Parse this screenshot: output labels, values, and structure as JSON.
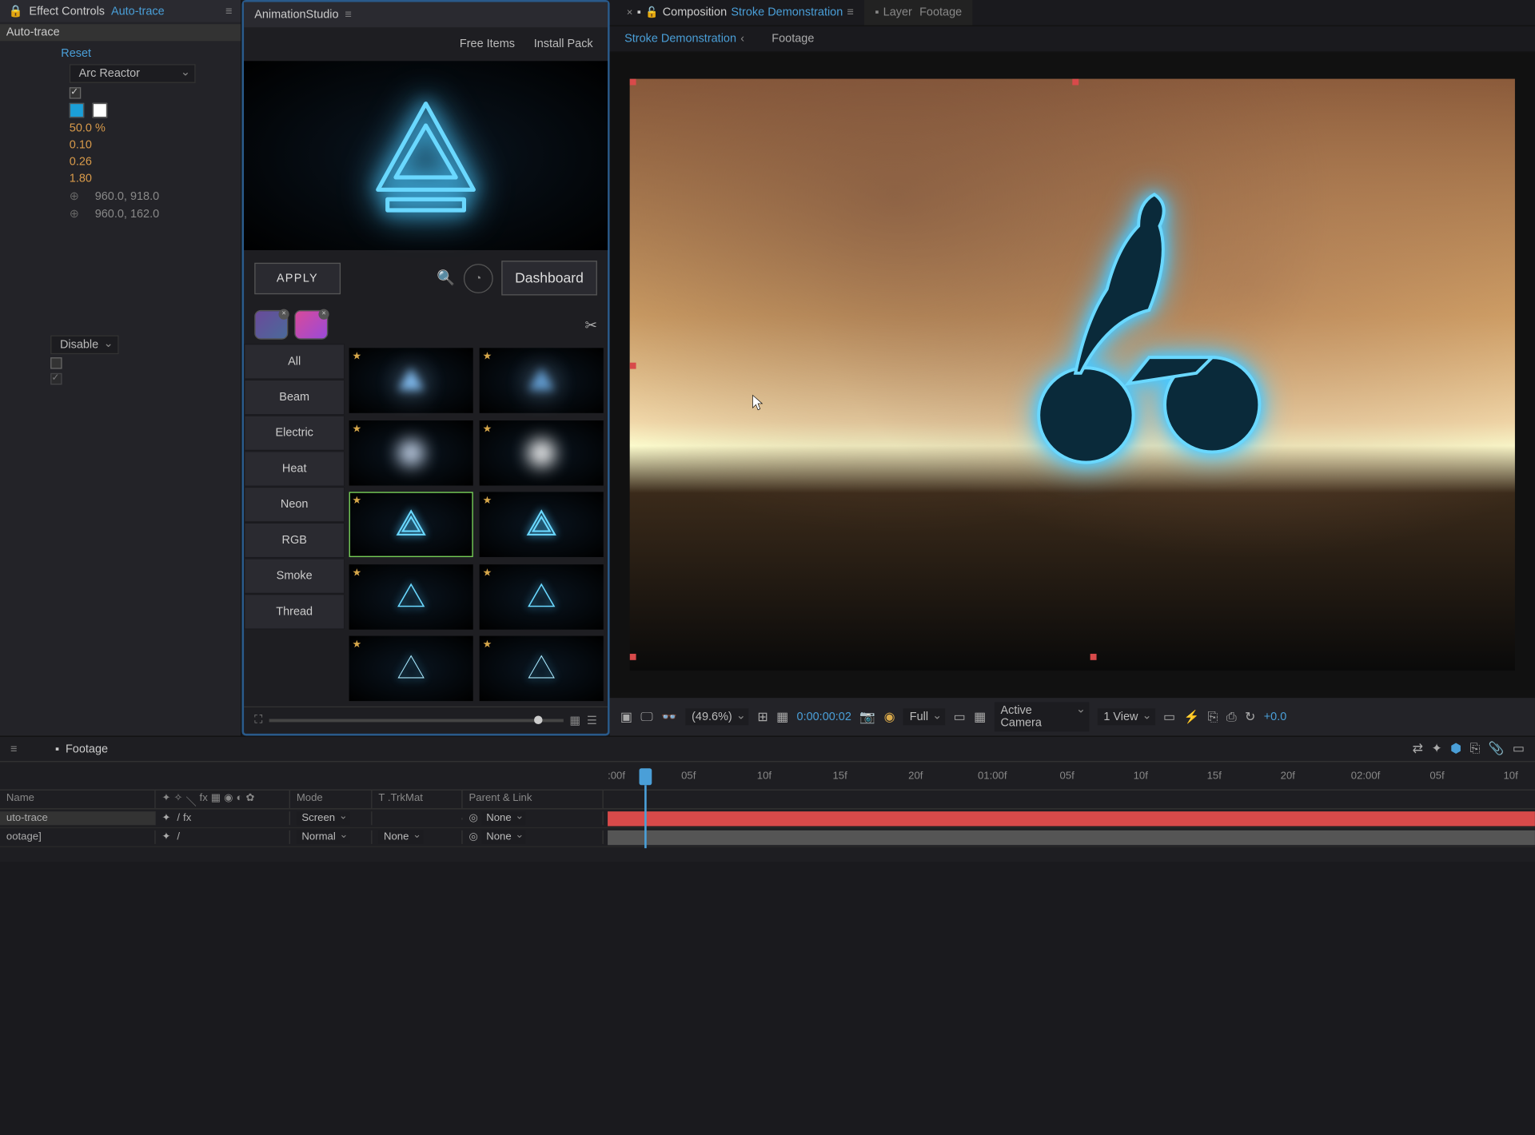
{
  "effectControls": {
    "title": "Effect Controls",
    "layerName": "Auto-trace",
    "subheader": "Auto-trace",
    "reset": "Reset",
    "presetName": "Arc Reactor",
    "props": {
      "percent": "50.0 %",
      "val1": "0.10",
      "val2": "0.26",
      "val3": "1.80",
      "coord1": "960.0, 918.0",
      "coord2": "960.0, 162.0"
    },
    "disable": "Disable"
  },
  "animStudio": {
    "title": "AnimationStudio",
    "freeItems": "Free Items",
    "installPack": "Install Pack",
    "apply": "APPLY",
    "dashboard": "Dashboard",
    "categories": [
      "All",
      "Beam",
      "Electric",
      "Heat",
      "Neon",
      "RGB",
      "Smoke",
      "Thread"
    ]
  },
  "composition": {
    "label": "Composition",
    "name": "Stroke Demonstration",
    "layerTab": "Layer",
    "footageTab": "Footage",
    "subTab1": "Stroke Demonstration",
    "subTab2": "Footage",
    "toolbar": {
      "zoom": "(49.6%)",
      "time": "0:00:00:02",
      "resolution": "Full",
      "camera": "Active Camera",
      "view": "1 View",
      "exposure": "+0.0"
    }
  },
  "timeline": {
    "footageTab": "Footage",
    "columns": {
      "name": "Name",
      "mode": "Mode",
      "trkmat": "T .TrkMat",
      "parent": "Parent & Link"
    },
    "ruler": [
      ":00f",
      "05f",
      "10f",
      "15f",
      "20f",
      "01:00f",
      "05f",
      "10f",
      "15f",
      "20f",
      "02:00f",
      "05f",
      "10f"
    ],
    "layers": [
      {
        "name": "uto-trace",
        "mode": "Screen",
        "trkmat": "",
        "parent": "None"
      },
      {
        "name": "ootage]",
        "mode": "Normal",
        "trkmat": "None",
        "parent": "None"
      }
    ]
  }
}
